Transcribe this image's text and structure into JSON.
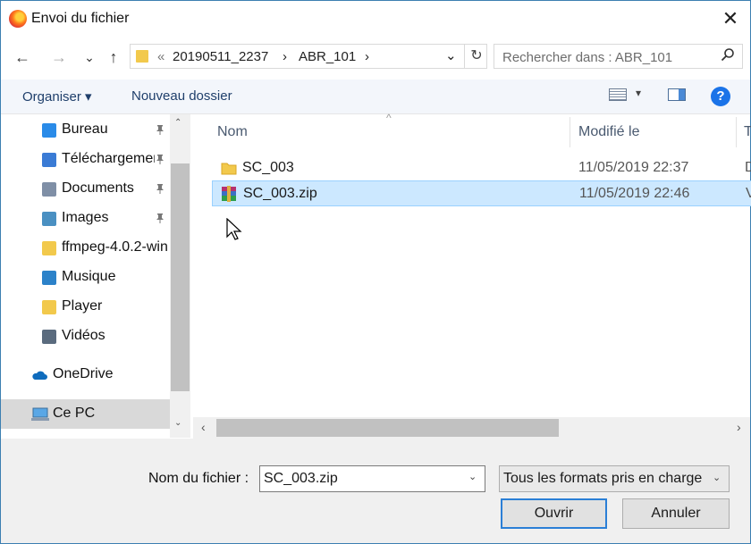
{
  "window": {
    "title": "Envoi du fichier",
    "close": "✕"
  },
  "nav": {
    "back": "←",
    "forward": "→",
    "recent": "⌄",
    "up": "↑",
    "address_prefix": "«",
    "crumbs": [
      "20190511_2237",
      "ABR_101"
    ],
    "sep": "›",
    "address_dropdown": "⌄",
    "refresh": "↻",
    "search_placeholder": "Rechercher dans : ABR_101"
  },
  "toolbar": {
    "organize": "Organiser ▾",
    "new_folder": "Nouveau dossier",
    "view_caret": "▾",
    "help": "?"
  },
  "sidebar": {
    "items": [
      {
        "label": "Bureau",
        "icon": "desktop-folder-icon",
        "color": "#2a8be8",
        "pinned": true
      },
      {
        "label": "Téléchargements",
        "icon": "downloads-icon",
        "color": "#3a7bd5",
        "pinned": true
      },
      {
        "label": "Documents",
        "icon": "documents-icon",
        "color": "#7f8fa6",
        "pinned": true
      },
      {
        "label": "Images",
        "icon": "pictures-icon",
        "color": "#4a90c2",
        "pinned": true
      },
      {
        "label": "ffmpeg-4.0.2-win",
        "icon": "folder-icon",
        "color": "#f2c94c",
        "pinned": false
      },
      {
        "label": "Musique",
        "icon": "music-icon",
        "color": "#2c82c9",
        "pinned": false
      },
      {
        "label": "Player",
        "icon": "folder-icon",
        "color": "#f2c94c",
        "pinned": false
      },
      {
        "label": "Vidéos",
        "icon": "videos-icon",
        "color": "#5a6b7e",
        "pinned": false
      }
    ],
    "onedrive": "OneDrive",
    "this_pc": "Ce PC",
    "pin_glyph": "📌",
    "scroll_up": "⌃",
    "scroll_down": "⌄"
  },
  "list": {
    "columns": {
      "name": "Nom",
      "modified": "Modifié le",
      "type": "T"
    },
    "sort_arrow": "^",
    "rows": [
      {
        "name": "SC_003",
        "modified": "11/05/2019 22:37",
        "type": "D",
        "icon": "folder-icon",
        "selected": false
      },
      {
        "name": "SC_003.zip",
        "modified": "11/05/2019 22:46",
        "type": "V",
        "icon": "winrar-archive-icon",
        "selected": true
      }
    ],
    "hscroll_left": "‹",
    "hscroll_right": "›"
  },
  "footer": {
    "filename_label": "Nom du fichier :",
    "filename_value": "SC_003.zip",
    "filter_value": "Tous les formats pris en charge",
    "ok": "Ouvrir",
    "cancel": "Annuler",
    "dd": "⌄"
  },
  "colors": {
    "accent": "#2b7fd6",
    "selection": "#cce8ff",
    "folder": "#f2c94c"
  }
}
